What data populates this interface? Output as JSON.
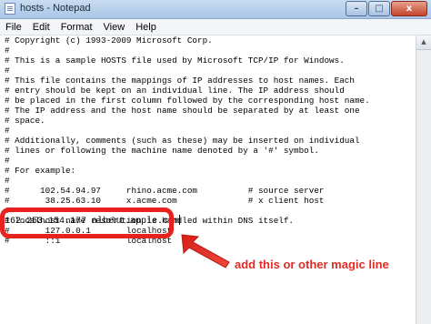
{
  "window": {
    "title": "hosts - Notepad",
    "controls": {
      "minimize": "–",
      "maximize": "□",
      "close": "x"
    }
  },
  "menu": [
    "File",
    "Edit",
    "Format",
    "View",
    "Help"
  ],
  "editor": {
    "content": "# Copyright (c) 1993-2009 Microsoft Corp.\n#\n# This is a sample HOSTS file used by Microsoft TCP/IP for Windows.\n#\n# This file contains the mappings of IP addresses to host names. Each\n# entry should be kept on an individual line. The IP address should\n# be placed in the first column followed by the corresponding host name.\n# The IP address and the host name should be separated by at least one\n# space.\n#\n# Additionally, comments (such as these) may be inserted on individual\n# lines or following the machine name denoted by a '#' symbol.\n#\n# For example:\n#\n#      102.54.94.97     rhino.acme.com          # source server\n#       38.25.63.10     x.acme.com              # x client host\n#\n# localhost name resolution is handled within DNS itself.\n#\t127.0.0.1       localhost\n#\t::1             localhost",
    "added_line": "162.253.154.177 albert.apple.com"
  },
  "annotation": {
    "text": "add this or other magic line",
    "color": "#e22b24"
  }
}
